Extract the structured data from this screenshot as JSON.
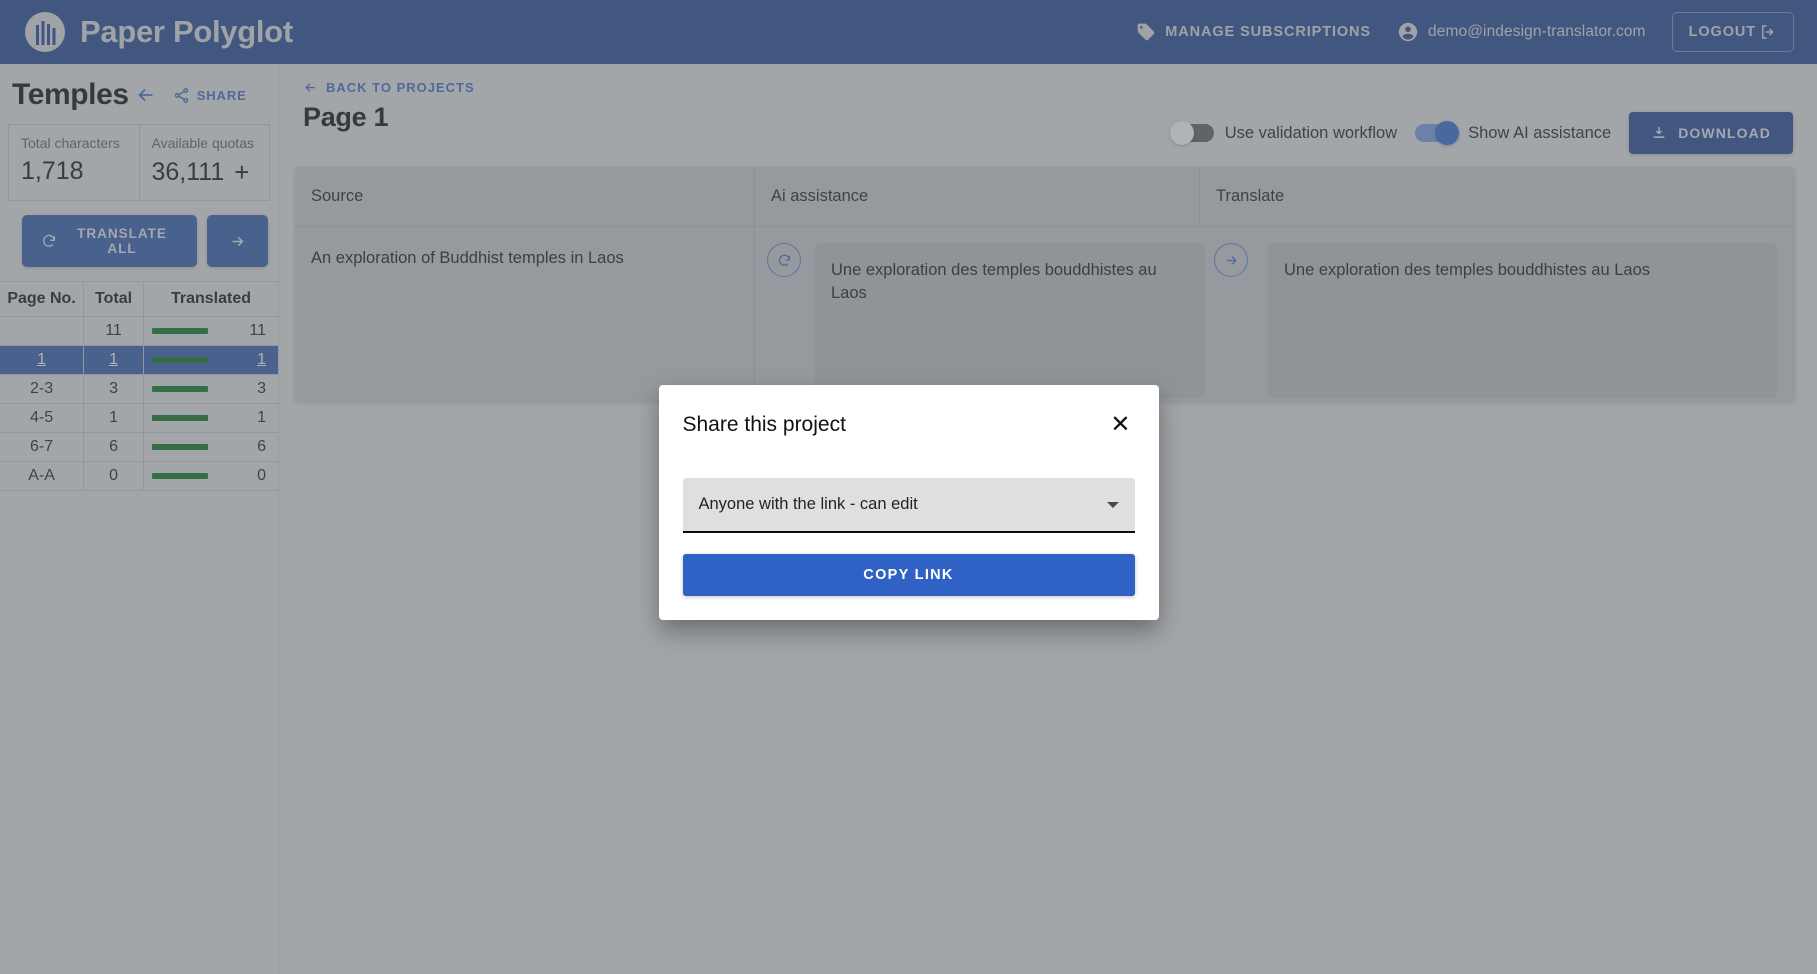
{
  "topbar": {
    "brand": "Paper Polyglot",
    "logo_icon": "circle-bars-logo-icon",
    "manage_subscriptions": "MANAGE SUBSCRIPTIONS",
    "manage_icon": "tag-icon",
    "user_email": "demo@indesign-translator.com",
    "user_icon": "account-circle-icon",
    "logout": "LOGOUT",
    "logout_icon": "logout-arrow-icon",
    "bg_color": "#1f4389",
    "text_color": "#c9cbce"
  },
  "sidebar": {
    "project_title": "Temples",
    "back_icon": "arrow-left-icon",
    "share_label": "SHARE",
    "share_icon": "share-nodes-icon",
    "stats": [
      {
        "label": "Total characters",
        "value": "1,718",
        "has_plus": false
      },
      {
        "label": "Available quotas",
        "value": "36,111",
        "has_plus": true,
        "plus": "+"
      }
    ],
    "translate_all": "TRANSLATE ALL",
    "translate_all_icon": "refresh-icon",
    "next_icon": "arrow-right-icon",
    "table": {
      "columns": [
        "Page No.",
        "Total",
        "Translated"
      ],
      "rows": [
        {
          "page": "",
          "total": "11",
          "translated": "11",
          "progress": 100,
          "selected": false
        },
        {
          "page": "1",
          "total": "1",
          "translated": "1",
          "progress": 100,
          "selected": true
        },
        {
          "page": "2-3",
          "total": "3",
          "translated": "3",
          "progress": 100,
          "selected": false
        },
        {
          "page": "4-5",
          "total": "1",
          "translated": "1",
          "progress": 100,
          "selected": false
        },
        {
          "page": "6-7",
          "total": "6",
          "translated": "6",
          "progress": 100,
          "selected": false
        },
        {
          "page": "A-A",
          "total": "0",
          "translated": "0",
          "progress": 100,
          "selected": false
        }
      ]
    }
  },
  "main": {
    "breadcrumb": "BACK TO PROJECTS",
    "breadcrumb_icon": "arrow-left-icon",
    "page_title": "Page 1",
    "toggles": [
      {
        "label": "Use validation workflow",
        "state": "off"
      },
      {
        "label": "Show AI assistance",
        "state": "on"
      }
    ],
    "download_label": "DOWNLOAD",
    "download_icon": "download-icon",
    "card": {
      "headers": [
        "Source",
        "Ai assistance",
        "Translate"
      ],
      "source_text": "An exploration of Buddhist temples in Laos",
      "ai_regenerate_icon": "refresh-circle-icon",
      "ai_text": "Une exploration des temples bouddhistes au Laos",
      "push_icon": "arrow-right-circle-icon",
      "translate_text": "Une exploration des temples bouddhistes au Laos"
    }
  },
  "modal": {
    "title": "Share this project",
    "close_icon": "close-icon",
    "permission_value": "Anyone with the link - can edit",
    "dropdown_icon": "chevron-down-icon",
    "copy_link": "COPY LINK",
    "accent_color": "#2f62c4"
  }
}
